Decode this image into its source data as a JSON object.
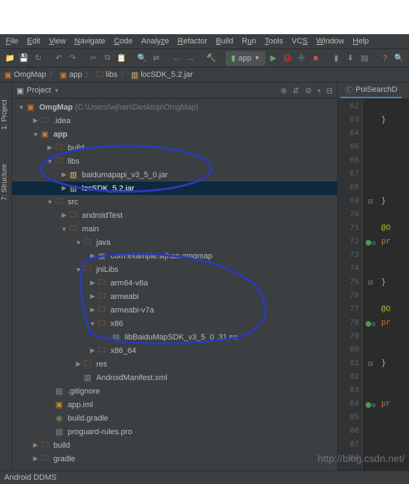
{
  "menu": {
    "file": "File",
    "edit": "Edit",
    "view": "View",
    "navigate": "Navigate",
    "code": "Code",
    "analyze": "Analyze",
    "refactor": "Refactor",
    "build": "Build",
    "run": "Run",
    "tools": "Tools",
    "vcs": "VCS",
    "window": "Window",
    "help": "Help"
  },
  "run_config": {
    "name": "app"
  },
  "breadcrumb": {
    "p0": "OmgMap",
    "p1": "app",
    "p2": "libs",
    "p3": "locSDK_5.2.jar"
  },
  "project_panel": {
    "title": "Project"
  },
  "sidebar": {
    "tab1": "1: Project",
    "tab2": "7: Structure"
  },
  "tree": {
    "root": {
      "name": "OmgMap",
      "path": "(C:\\Users\\wjhan\\Desktop\\OmgMap)"
    },
    "idea": ".idea",
    "app": "app",
    "build": "build",
    "libs": "libs",
    "jar1": "baidumapapi_v3_5_0.jar",
    "jar2": "locSDK_5.2.jar",
    "src": "src",
    "androidTest": "androidTest",
    "main": "main",
    "java": "java",
    "pkg": "com.example.wjhan.omgmap",
    "jniLibs": "jniLibs",
    "arm64": "arm64-v8a",
    "armeabi": "armeabi",
    "armeabiv7": "armeabi-v7a",
    "x86": "x86",
    "so": "libBaiduMapSDK_v3_5_0_31.so",
    "x8664": "x86_64",
    "res": "res",
    "manifest": "AndroidManifest.xml",
    "gitignore": ".gitignore",
    "appiml": "app.iml",
    "buildgradle": "build.gradle",
    "proguard": "proguard-rules.pro",
    "build2": "build",
    "gradle": "gradle"
  },
  "editor": {
    "tab": "PoiSearchD"
  },
  "gutter": {
    "start": 62,
    "end": 88
  },
  "code_lines": [
    {
      "n": 62,
      "t": ""
    },
    {
      "n": 63,
      "t": "    }"
    },
    {
      "n": 64,
      "t": ""
    },
    {
      "n": 65,
      "t": ""
    },
    {
      "n": 66,
      "t": ""
    },
    {
      "n": 67,
      "t": ""
    },
    {
      "n": 68,
      "t": ""
    },
    {
      "n": 69,
      "t": "    }",
      "mark": "fold"
    },
    {
      "n": 70,
      "t": ""
    },
    {
      "n": 71,
      "t": "    @O",
      "ann": true
    },
    {
      "n": 72,
      "t": "    pr",
      "kw": true,
      "mark": "impl"
    },
    {
      "n": 73,
      "t": ""
    },
    {
      "n": 74,
      "t": ""
    },
    {
      "n": 75,
      "t": "    }",
      "mark": "fold"
    },
    {
      "n": 76,
      "t": ""
    },
    {
      "n": 77,
      "t": "    @O",
      "ann": true
    },
    {
      "n": 78,
      "t": "    pr",
      "kw": true,
      "mark": "impl"
    },
    {
      "n": 79,
      "t": ""
    },
    {
      "n": 80,
      "t": ""
    },
    {
      "n": 81,
      "t": "    }",
      "mark": "fold"
    },
    {
      "n": 82,
      "t": ""
    },
    {
      "n": 83,
      "t": ""
    },
    {
      "n": 84,
      "t": "    pr",
      "kw": true,
      "mark": "impl"
    },
    {
      "n": 85,
      "t": ""
    },
    {
      "n": 86,
      "t": ""
    },
    {
      "n": 87,
      "t": ""
    },
    {
      "n": 88,
      "t": ""
    }
  ],
  "statusbar": {
    "left": "Android DDMS"
  },
  "watermark": "http://blog.csdn.net/"
}
